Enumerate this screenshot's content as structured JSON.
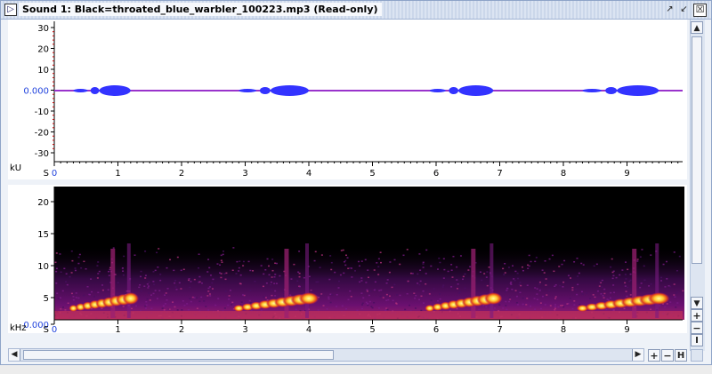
{
  "window": {
    "title": "Sound 1: Black=throated_blue_warbler_100223.mp3 (Read-only)"
  },
  "title_buttons": {
    "restore": "↗",
    "maximize": "↙",
    "close": "☒"
  },
  "waveform": {
    "unit": "kU",
    "y_ticks": [
      "30",
      "20",
      "10",
      "0.000",
      "-10",
      "-20",
      "-30"
    ],
    "x_axis_start": "S",
    "x_ticks": [
      "0",
      "1",
      "2",
      "3",
      "4",
      "5",
      "6",
      "7",
      "8",
      "9"
    ]
  },
  "spectrogram": {
    "unit": "kHz",
    "y_ticks": [
      "20",
      "15",
      "10",
      "5",
      "0.000"
    ],
    "x_axis_start": "S",
    "x_ticks": [
      "0",
      "1",
      "2",
      "3",
      "4",
      "5",
      "6",
      "7",
      "8",
      "9"
    ]
  },
  "song_phrases_seconds": [
    [
      0.3,
      1.2
    ],
    [
      2.9,
      4.0
    ],
    [
      5.9,
      6.9
    ],
    [
      8.3,
      9.5
    ]
  ],
  "controls": {
    "zoom_in": "+",
    "zoom_out": "−",
    "fit_vertical": "I",
    "fit_horizontal": "H",
    "scroll_left": "◀",
    "scroll_right": "▶",
    "scroll_up": "▲",
    "scroll_down": "▼"
  },
  "colors": {
    "waveform": "#3333ff",
    "baseline": "#9933cc",
    "zero_label": "#2244dd",
    "spectrogram_bg": "#000000",
    "spectrogram_hot": "#ffff66"
  }
}
